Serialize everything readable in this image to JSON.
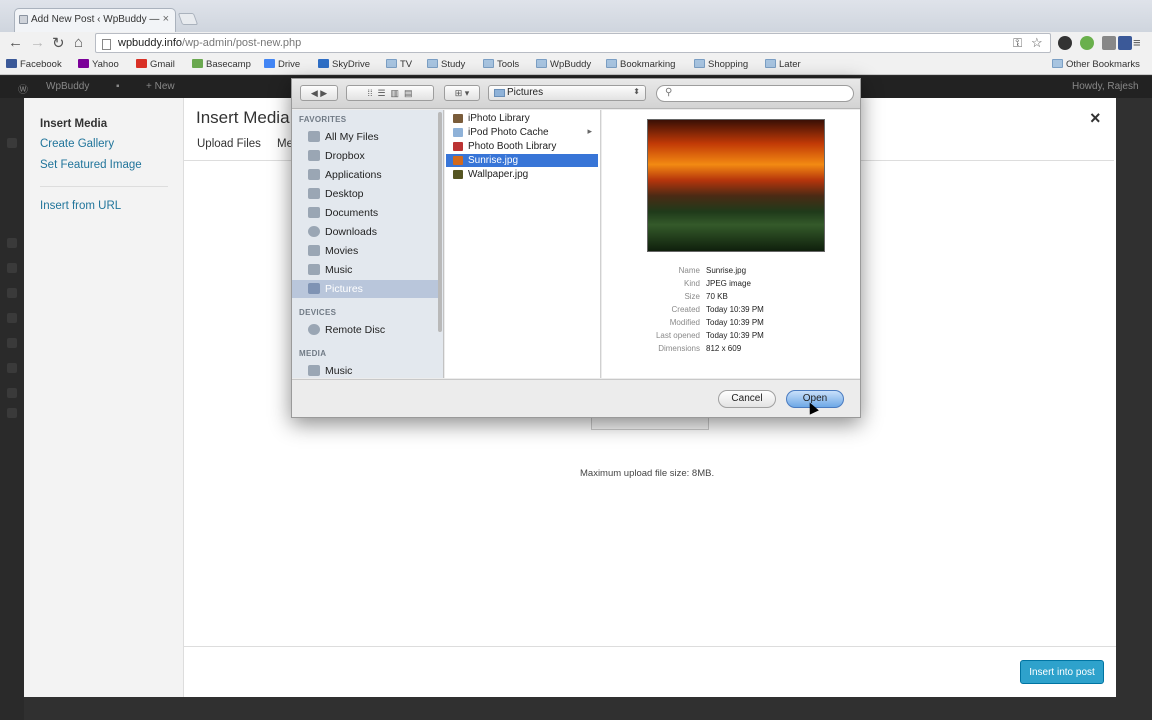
{
  "browser": {
    "tab_title": "Add New Post ‹ WpBuddy —",
    "tab_close": "×",
    "url_domain": "wpbuddy.info",
    "url_path": "/wp-admin/post-new.php"
  },
  "bookmarks": [
    {
      "label": "Facebook",
      "color": "#3b5998"
    },
    {
      "label": "Yahoo",
      "color": "#7b0099"
    },
    {
      "label": "Gmail",
      "color": "#d93025"
    },
    {
      "label": "Basecamp",
      "color": "#6aa84f"
    },
    {
      "label": "Drive",
      "color": "#4285f4"
    },
    {
      "label": "SkyDrive",
      "color": "#2f6fc6"
    },
    {
      "label": "TV",
      "color": "folder"
    },
    {
      "label": "Study",
      "color": "folder"
    },
    {
      "label": "Tools",
      "color": "folder"
    },
    {
      "label": "WpBuddy",
      "color": "folder"
    },
    {
      "label": "Bookmarking",
      "color": "folder"
    },
    {
      "label": "Shopping",
      "color": "folder"
    },
    {
      "label": "Later",
      "color": "folder"
    }
  ],
  "other_bookmarks": "Other Bookmarks",
  "wp_admin": {
    "site_name": "WpBuddy",
    "new_label": "+ New",
    "howdy": "Howdy, Rajesh"
  },
  "media_modal": {
    "sidebar": [
      "Insert Media",
      "Create Gallery",
      "Set Featured Image",
      "Insert from URL"
    ],
    "title": "Insert Media",
    "tabs": [
      "Upload Files",
      "Media Library"
    ],
    "close": "×",
    "max_upload": "Maximum upload file size: 8MB.",
    "insert_button": "Insert into post"
  },
  "file_dialog": {
    "current_folder": "Pictures",
    "search_placeholder": "",
    "sections": {
      "favorites": "FAVORITES",
      "devices": "DEVICES",
      "media": "MEDIA"
    },
    "favorites": [
      "All My Files",
      "Dropbox",
      "Applications",
      "Desktop",
      "Documents",
      "Downloads",
      "Movies",
      "Music",
      "Pictures"
    ],
    "devices": [
      "Remote Disc"
    ],
    "media": [
      "Music"
    ],
    "selected_sidebar": "Pictures",
    "files": [
      "iPhoto Library",
      "iPod Photo Cache",
      "Photo Booth Library",
      "Sunrise.jpg",
      "Wallpaper.jpg"
    ],
    "selected_file": "Sunrise.jpg",
    "info": [
      {
        "key": "Name",
        "value": "Sunrise.jpg"
      },
      {
        "key": "Kind",
        "value": "JPEG image"
      },
      {
        "key": "Size",
        "value": "70 KB"
      },
      {
        "key": "Created",
        "value": "Today 10:39 PM"
      },
      {
        "key": "Modified",
        "value": "Today 10:39 PM"
      },
      {
        "key": "Last opened",
        "value": "Today 10:39 PM"
      },
      {
        "key": "Dimensions",
        "value": "812 x 609"
      }
    ],
    "cancel": "Cancel",
    "open": "Open"
  }
}
